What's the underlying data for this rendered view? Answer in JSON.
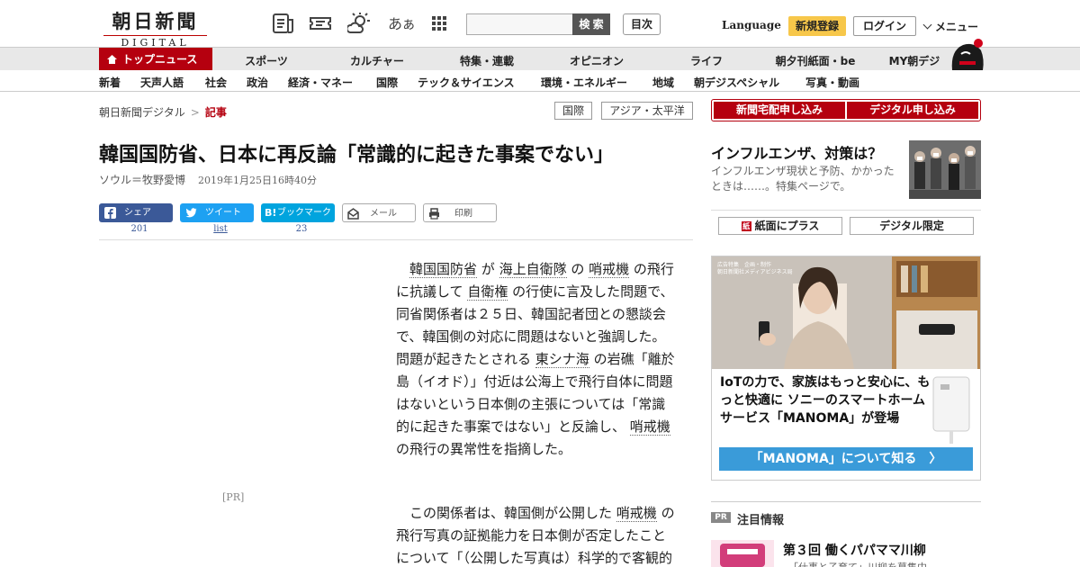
{
  "header": {
    "logo_jp": "朝日新聞",
    "logo_en": "DIGITAL",
    "fontsize_glyph": "あぁ",
    "search_button": "検 索",
    "toc_button": "目次",
    "language": "Language",
    "register": "新規登録",
    "login": "ログイン",
    "menu": "メニュー",
    "icons": [
      "newspaper-icon",
      "ticket-icon",
      "weather-icon",
      "font-size-icon",
      "grid-icon"
    ]
  },
  "nav_primary": {
    "top": "トップニュース",
    "items": [
      "スポーツ",
      "カルチャー",
      "特集・連載",
      "オピニオン",
      "ライフ",
      "朝夕刊紙面・be",
      "MY朝デジ"
    ]
  },
  "nav_secondary": {
    "items": [
      "新着",
      "天声人語",
      "社会",
      "政治",
      "経済・マネー",
      "国際",
      "テック＆サイエンス",
      "環境・エネルギー",
      "地域",
      "朝デジスペシャル",
      "写真・動画"
    ]
  },
  "breadcrumb": {
    "home": "朝日新聞デジタル",
    "sep": ">",
    "current": "記事"
  },
  "tags": [
    "国際",
    "アジア・太平洋"
  ],
  "apply": {
    "home_delivery": "新聞宅配申し込み",
    "digital": "デジタル申し込み"
  },
  "article": {
    "title": "韓国国防省、日本に再反論「常識的に起きた事案でない」",
    "author": "ソウル＝牧野愛博",
    "date": "2019年1月25日16時40分",
    "share": {
      "facebook": "シェア",
      "facebook_count": "201",
      "twitter": "ツイート",
      "twitter_count": "list",
      "hatena": "ブックマーク",
      "hatena_count": "23",
      "mail": "メール",
      "print": "印刷"
    },
    "pr_label": "[PR]",
    "p1": {
      "kw1": "韓国国防省",
      "t1": " が ",
      "kw2": "海上自衛隊",
      "t2": " の ",
      "kw3": "哨戒機",
      "t3": " の飛行に抗議して ",
      "kw4": "自衛権",
      "t4": " の行使に言及した問題で、同省関係者は２５日、韓国記者団との懇談会で、韓国側の対応に問題はないと強調した。問題が起きたとされる ",
      "kw5": "東シナ海",
      "t5": " の岩礁「離於島（イオド）」付近は公海上で飛行自体に問題はないという日本側の主張については「常識的に起きた事案ではない」と反論し、 ",
      "kw6": "哨戒機",
      "t6": " の飛行の異常性を指摘した。"
    },
    "p2": {
      "t1": "この関係者は、韓国側が公開した ",
      "kw1": "哨戒機",
      "t2": " の飛行写真の証拠能力を日本側が否定したことについて「（公開した写真は）科学的で客観的だ。日本が相応の資料を出すべき"
    }
  },
  "sidebar": {
    "feature_title": "インフルエンザ、対策は？",
    "feature_text": "インフルエンザ現状と予防、かかったときは……。特集ページで。",
    "paper_plus": "紙面にプラス",
    "digital_only": "デジタル限定",
    "ad": {
      "small1": "広告特集　企画・制作",
      "small2": "朝日新聞社メディアビジネス局",
      "headline": "IoTの力で、家族はもっと安心に、もっと快適に ソニーのスマートホームサービス「MANOMA」が登場",
      "cta": "「MANOMA」について知る　〉"
    },
    "pr_badge": "PR",
    "attention": "注目情報",
    "promo_title": "第３回 働くパパママ川柳",
    "promo_sub": "「仕事と子育て」川柳を募集中"
  },
  "colors": {
    "brand_red": "#b5000f",
    "register_yellow": "#f7c74a",
    "facebook": "#3b5998",
    "twitter": "#1da1f2",
    "hatena": "#00a4de",
    "cta_blue": "#3a9bd9"
  }
}
